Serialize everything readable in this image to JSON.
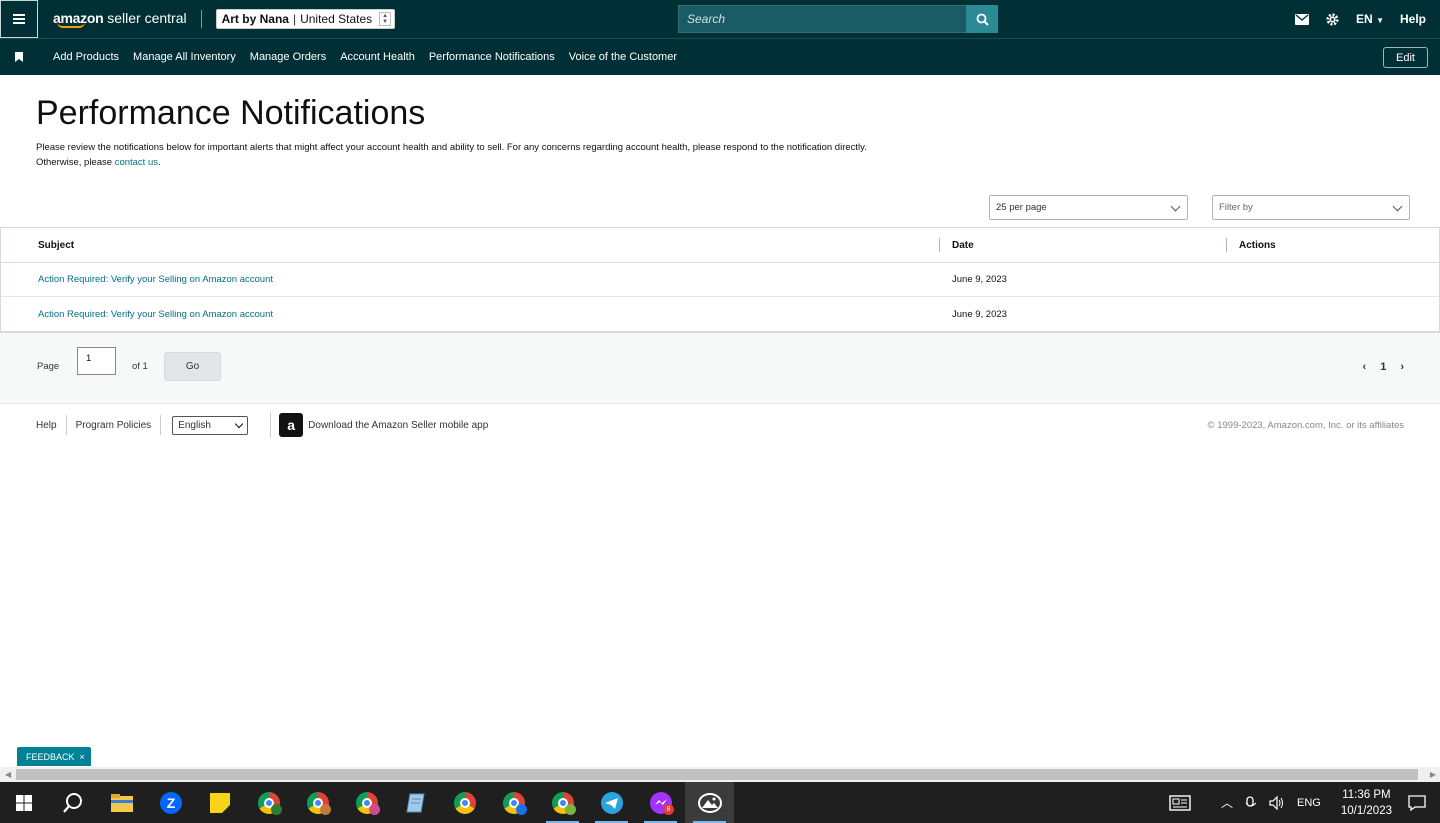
{
  "topbar": {
    "logo_main": "amazon",
    "logo_sub": "seller central",
    "account_name": "Art by Nana",
    "account_region": "United States",
    "search_placeholder": "Search",
    "lang": "EN",
    "help": "Help"
  },
  "nav": {
    "items": [
      "Add Products",
      "Manage All Inventory",
      "Manage Orders",
      "Account Health",
      "Performance Notifications",
      "Voice of the Customer"
    ],
    "edit": "Edit"
  },
  "page": {
    "title": "Performance Notifications",
    "intro": "Please review the notifications below for important alerts that might affect your account health and ability to sell. For any concerns regarding account health, please respond to the notification directly.",
    "intro_line2": "Otherwise, please ",
    "contact_link": "contact us",
    "intro_end": "."
  },
  "controls": {
    "per_page": "25 per page",
    "filter_placeholder": "Filter by"
  },
  "table": {
    "headers": {
      "subject": "Subject",
      "date": "Date",
      "actions": "Actions"
    },
    "rows": [
      {
        "subject": "Action Required: Verify your Selling on Amazon account",
        "date": "June 9, 2023"
      },
      {
        "subject": "Action Required: Verify your Selling on Amazon account",
        "date": "June 9, 2023"
      }
    ]
  },
  "pager": {
    "page_label": "Page",
    "page_value": "1",
    "of_label": "of 1",
    "go": "Go",
    "current": "1",
    "prev": "‹",
    "next": "›"
  },
  "footer": {
    "help": "Help",
    "policies": "Program Policies",
    "language": "English",
    "app_icon_letter": "a",
    "app_download": "Download the Amazon Seller mobile app",
    "copyright": "© 1999-2023, Amazon.com, Inc. or its affiliates"
  },
  "feedback": {
    "label": "FEEDBACK",
    "close": "×"
  },
  "taskbar": {
    "lang": "ENG",
    "time": "11:36 PM",
    "date": "10/1/2023",
    "messenger_badge": "8"
  },
  "colors": {
    "header_bg": "#002f36",
    "link": "#007185",
    "feedback": "#008296",
    "search_btn": "#2b8a96"
  }
}
